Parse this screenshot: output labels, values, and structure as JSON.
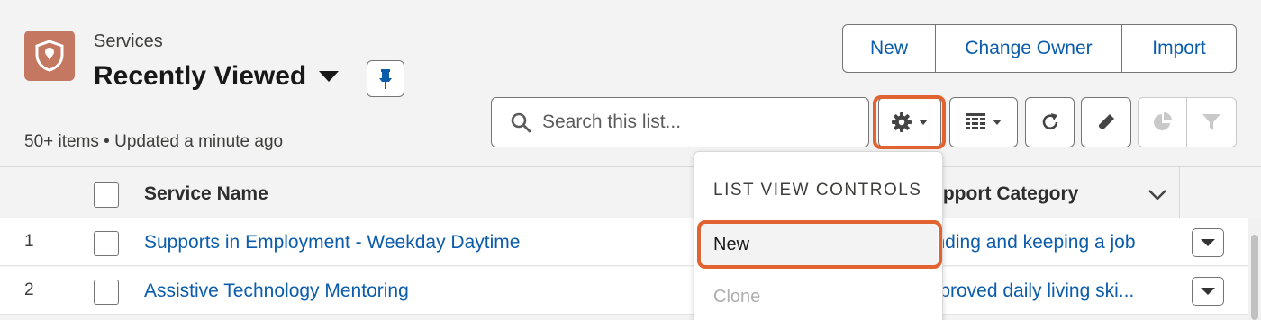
{
  "header": {
    "object_label": "Services",
    "view_title": "Recently Viewed",
    "status": "50+ items • Updated a minute ago"
  },
  "actions": {
    "new": "New",
    "change_owner": "Change Owner",
    "import": "Import"
  },
  "search": {
    "placeholder": "Search this list..."
  },
  "toolbar": {
    "icons": [
      "gear-icon",
      "table-icon",
      "refresh-icon",
      "pencil-icon",
      "pie-chart-icon",
      "filter-icon"
    ]
  },
  "table": {
    "columns": [
      "Service Name",
      "Support Category"
    ],
    "rows": [
      {
        "num": "1",
        "name": "Supports in Employment - Weekday Daytime",
        "category": "Finding and keeping a job"
      },
      {
        "num": "2",
        "name": "Assistive Technology Mentoring",
        "category": "Improved daily living ski..."
      }
    ]
  },
  "dropdown": {
    "heading": "LIST VIEW CONTROLS",
    "items": [
      "New",
      "Clone"
    ]
  },
  "colors": {
    "accent": "#0b5cab",
    "object_icon": "#c47862",
    "highlight": "#e06331"
  }
}
